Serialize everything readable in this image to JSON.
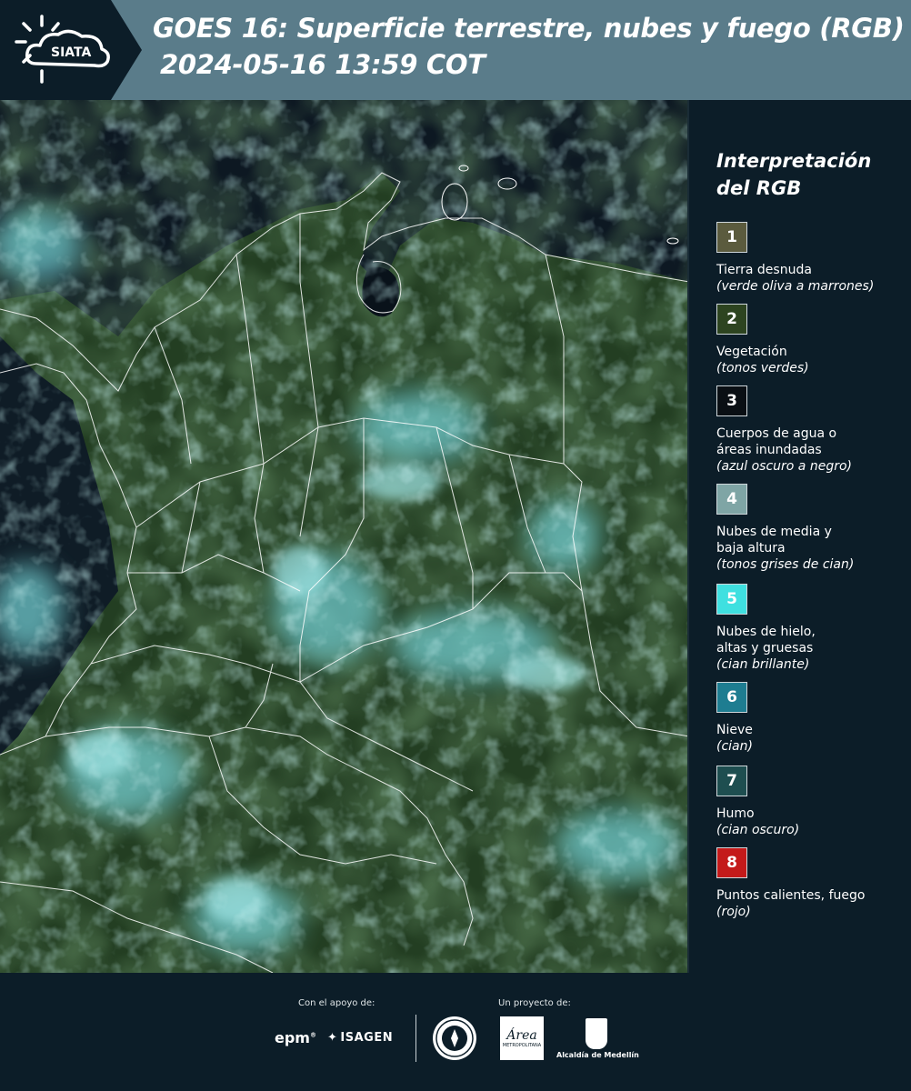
{
  "header": {
    "logo_text": "SIATA",
    "title_line1": "GOES 16: Superficie terrestre, nubes y fuego (RGB)",
    "title_line2": "2024-05-16 13:59 COT"
  },
  "legend": {
    "title": "Interpretación del RGB",
    "items": [
      {
        "number": "1",
        "color": "#5b5b3e",
        "label": "Tierra desnuda",
        "sub": "(verde oliva a marrones)"
      },
      {
        "number": "2",
        "color": "#2d4420",
        "label": "Vegetación",
        "sub": "(tonos verdes)"
      },
      {
        "number": "3",
        "color": "#0a0f14",
        "label": "Cuerpos de agua o áreas inundadas",
        "sub": "(azul oscuro a negro)"
      },
      {
        "number": "4",
        "color": "#7fa5a5",
        "label": "Nubes de media y baja altura",
        "sub": "(tonos grises de cian)"
      },
      {
        "number": "5",
        "color": "#3fe0e0",
        "label": "Nubes de hielo, altas y gruesas",
        "sub": "(cian brillante)"
      },
      {
        "number": "6",
        "color": "#1e7d91",
        "label": "Nieve",
        "sub": "(cian)"
      },
      {
        "number": "7",
        "color": "#1e4e50",
        "label": "Humo",
        "sub": "(cian oscuro)"
      },
      {
        "number": "8",
        "color": "#c41a1a",
        "label": "Puntos calientes, fuego",
        "sub": "(rojo)"
      }
    ]
  },
  "footer": {
    "support_label": "Con el apoyo de:",
    "project_label": "Un proyecto de:",
    "epm": "epm",
    "isagen": "ISAGEN",
    "amva_mark": "Área",
    "amva_sub": "METROPOLITANA",
    "medellin": "Alcaldía de Medellín"
  }
}
